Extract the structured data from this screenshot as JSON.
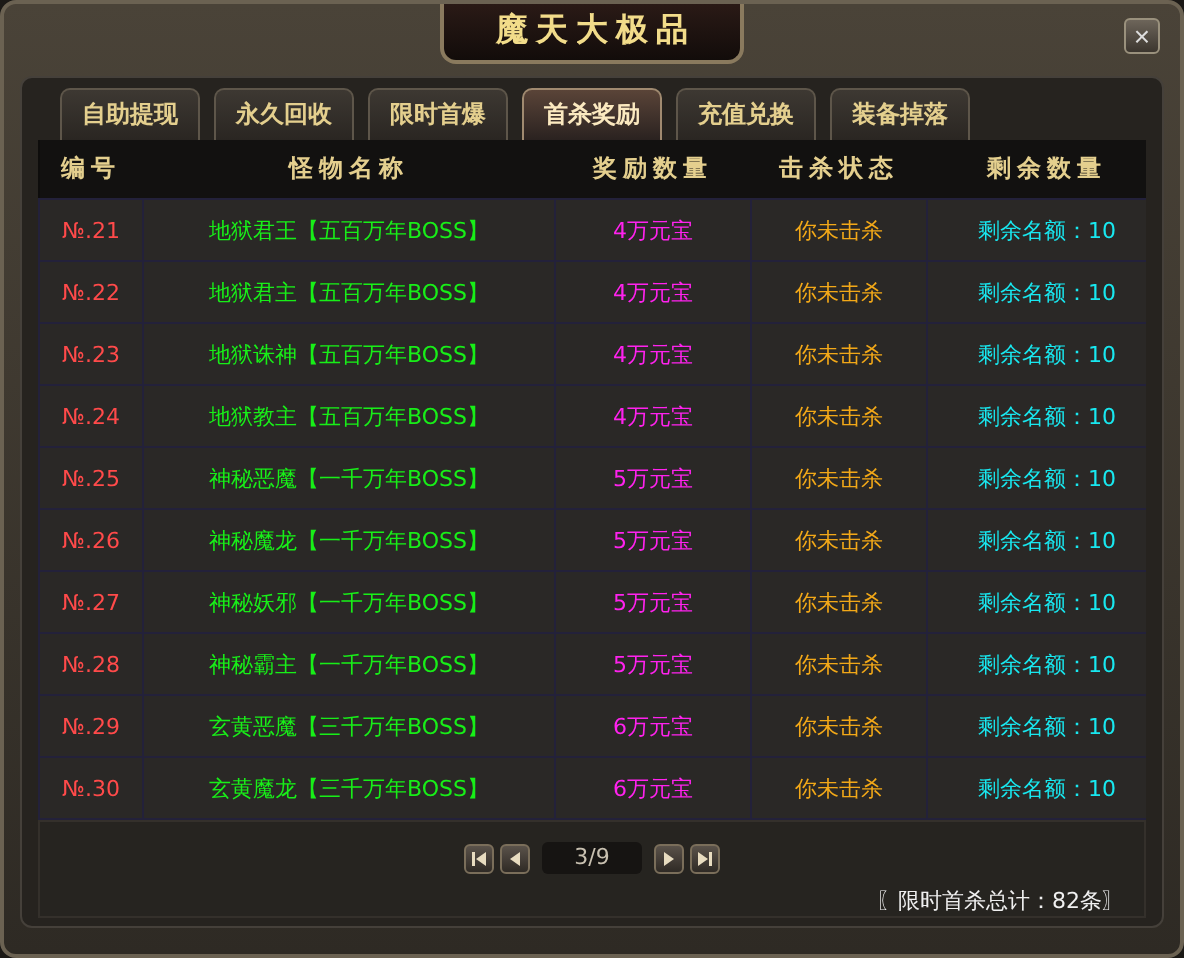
{
  "window": {
    "title": "魔天大极品",
    "close": "×"
  },
  "tabs": [
    {
      "label": "自助提现",
      "selected": false
    },
    {
      "label": "永久回收",
      "selected": false
    },
    {
      "label": "限时首爆",
      "selected": false
    },
    {
      "label": "首杀奖励",
      "selected": true
    },
    {
      "label": "充值兑换",
      "selected": false
    },
    {
      "label": "装备掉落",
      "selected": false
    }
  ],
  "table": {
    "columns": [
      "编号",
      "怪物名称",
      "奖励数量",
      "击杀状态",
      "剩余数量"
    ],
    "rows": [
      {
        "number": "№.21",
        "monster": "地狱君王【五百万年BOSS】",
        "reward": "4万元宝",
        "status": "你未击杀",
        "remaining": "剩余名额：10"
      },
      {
        "number": "№.22",
        "monster": "地狱君主【五百万年BOSS】",
        "reward": "4万元宝",
        "status": "你未击杀",
        "remaining": "剩余名额：10"
      },
      {
        "number": "№.23",
        "monster": "地狱诛神【五百万年BOSS】",
        "reward": "4万元宝",
        "status": "你未击杀",
        "remaining": "剩余名额：10"
      },
      {
        "number": "№.24",
        "monster": "地狱教主【五百万年BOSS】",
        "reward": "4万元宝",
        "status": "你未击杀",
        "remaining": "剩余名额：10"
      },
      {
        "number": "№.25",
        "monster": "神秘恶魔【一千万年BOSS】",
        "reward": "5万元宝",
        "status": "你未击杀",
        "remaining": "剩余名额：10"
      },
      {
        "number": "№.26",
        "monster": "神秘魔龙【一千万年BOSS】",
        "reward": "5万元宝",
        "status": "你未击杀",
        "remaining": "剩余名额：10"
      },
      {
        "number": "№.27",
        "monster": "神秘妖邪【一千万年BOSS】",
        "reward": "5万元宝",
        "status": "你未击杀",
        "remaining": "剩余名额：10"
      },
      {
        "number": "№.28",
        "monster": "神秘霸主【一千万年BOSS】",
        "reward": "5万元宝",
        "status": "你未击杀",
        "remaining": "剩余名额：10"
      },
      {
        "number": "№.29",
        "monster": "玄黄恶魔【三千万年BOSS】",
        "reward": "6万元宝",
        "status": "你未击杀",
        "remaining": "剩余名额：10"
      },
      {
        "number": "№.30",
        "monster": "玄黄魔龙【三千万年BOSS】",
        "reward": "6万元宝",
        "status": "你未击杀",
        "remaining": "剩余名额：10"
      }
    ]
  },
  "pager": {
    "page": "3/9"
  },
  "summary": "〖限时首杀总计：82条〗"
}
